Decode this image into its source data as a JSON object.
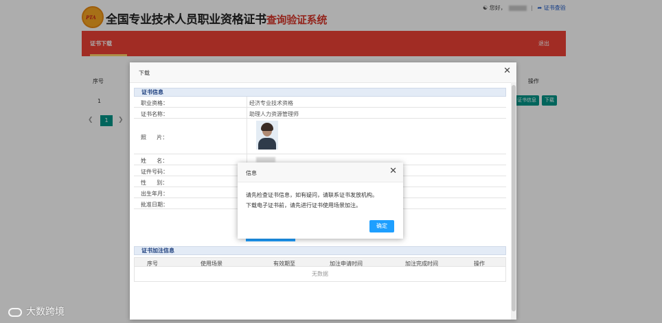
{
  "header": {
    "logo_text": "PTA",
    "title_main": "全国专业技术人员职业资格证书",
    "title_sub": "查询验证系统",
    "greeting": "您好，",
    "verify_link": "证书查验"
  },
  "nav": {
    "tab_download": "证书下载",
    "logout": "退出"
  },
  "background_table": {
    "col_index": "序号",
    "col_action": "操作",
    "row_index": "1",
    "btn_info": "证书信息",
    "btn_download": "下载",
    "current_page": "1"
  },
  "download_dialog": {
    "title": "下载",
    "cert_section_title": "证书信息",
    "rows": [
      {
        "label": "职业资格：",
        "value": "经济专业技术资格"
      },
      {
        "label": "证书名称：",
        "value": "助理人力资源管理师"
      },
      {
        "label": "照      片：",
        "value": ""
      },
      {
        "label": "姓      名：",
        "value": ""
      },
      {
        "label": "证件号码：",
        "value": ""
      },
      {
        "label": "性      别：",
        "value": ""
      },
      {
        "label": "出生年月：",
        "value": ""
      },
      {
        "label": "批准日期：",
        "value": ""
      }
    ],
    "note_section_title": "证书加注信息",
    "note_columns": [
      "序号",
      "使用场景",
      "有效期至",
      "加注申请时间",
      "加注完成时间",
      "操作"
    ],
    "note_empty": "无数据"
  },
  "message_dialog": {
    "title": "信息",
    "line1": "请先检查证书信息，如有疑问，请联系证书发放机构。",
    "line2": "下载电子证书前，请先进行证书使用场景加注。",
    "ok_label": "确定"
  },
  "watermark": "大数跨境",
  "colors": {
    "nav_red": "#ee4136",
    "primary_blue": "#1e9fff",
    "teal": "#009688",
    "title_red": "#d9372b"
  }
}
